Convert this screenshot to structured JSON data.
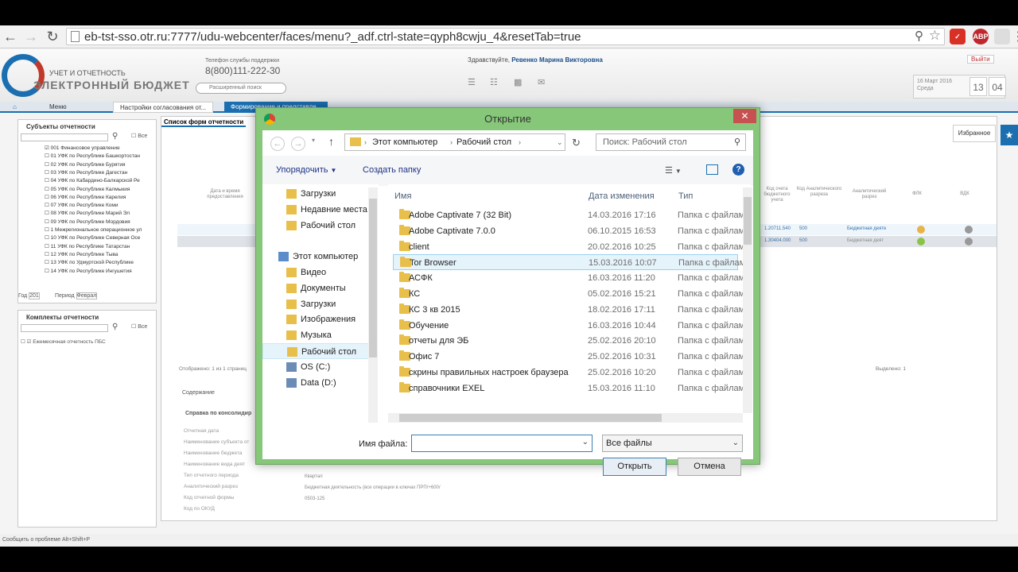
{
  "browser": {
    "url": "eb-tst-sso.otr.ru:7777/udu-webcenter/faces/menu?_adf.ctrl-state=qyph8cwju_4&resetTab=true",
    "ext_abp": "ABP"
  },
  "site": {
    "logo_sub": "УЧЕТ И ОТЧЕТНОСТЬ",
    "logo_main": "ЭЛЕКТРОННЫЙ БЮДЖЕТ",
    "hotline_label": "Телефон службы поддержки",
    "hotline": "8(800)111-222-30",
    "adv_search": "Расширенный поиск",
    "greeting_prefix": "Здравствуйте,",
    "greeting_name": "Ревенко Марина Викторовна",
    "exit": "Выйти",
    "date_line1": "16 Март 2016",
    "date_line2": "Среда",
    "date_day": "13",
    "date_month": "04",
    "favorites": "Избранное"
  },
  "tabs": [
    {
      "label": "Меню"
    },
    {
      "label": "Настройки согласования от..."
    },
    {
      "label": "Формирование и представле..."
    }
  ],
  "left_panel": {
    "title": "Субъекты отчетности",
    "all": "Все",
    "items": [
      "001 Финансовое управление",
      "01 УФК по Республике Башкортостан",
      "02 УФК по Республике Бурятия",
      "03 УФК по Республике Дагестан",
      "04 УФК по Кабардино-Балкарской Ре",
      "05 УФК по Республике Калмыкия",
      "06 УФК по Республике Карелия",
      "07 УФК по Республике Коми",
      "08 УФК по Республике Марий Эл",
      "09 УФК по Республике Мордовия",
      "1 Межрегиональное операционное ул",
      "10 УФК по Республике Северная Осе",
      "11 УФК по Республике Татарстан",
      "12 УФК по Республике Тыва",
      "13 УФК по Удмуртской Республике",
      "14 УФК по Республике Ингушетия"
    ],
    "year_label": "Год",
    "year_value": "201",
    "period_label": "Период",
    "period_value": "Феврал"
  },
  "kits_panel": {
    "title": "Комплекты отчетности",
    "all": "Все",
    "item": "Ежемесячная отчетность ПБС"
  },
  "main": {
    "tab": "Список форм отчетности",
    "col_date": "Дата и время предоставления",
    "col_form_code": "Код отчетной формы",
    "col_budget": "Код счета бюджетного учета",
    "col_analytic": "Код Аналитического разреза",
    "col_analytic2": "Аналитический разрез",
    "col_fk": "ФЛК",
    "col_vdk": "ВДК",
    "row1_budget": "1.20711.540",
    "row1_code": "500",
    "row1_text": "Бюджетная деяте",
    "row2_budget": "1.30404.000",
    "row2_code": "500",
    "row2_text": "Бюджетная деят",
    "shown": "Отображено: 1 из 1 страниц",
    "selected": "Выделено: 1",
    "content_tab": "Содержание",
    "report_ref": "Справка по консолидир",
    "fields": [
      "Отчетная дата",
      "Наименование субъекта от",
      "Наименование бюджета",
      "Наименование вида деят",
      "Тип отчетного периода",
      "Аналитический разрез",
      "Код отчетной формы",
      "Код по ОКУД"
    ],
    "field_values": [
      "Квартал",
      "Бюджетная деятельность (все операции в ключах ПРП/+600/",
      "0503-125"
    ]
  },
  "dialog": {
    "title": "Открытие",
    "path": [
      "Этот компьютер",
      "Рабочий стол"
    ],
    "search_placeholder": "Поиск: Рабочий стол",
    "organize": "Упорядочить",
    "new_folder": "Создать папку",
    "nav": [
      {
        "label": "Загрузки",
        "indent": 1
      },
      {
        "label": "Недавние места",
        "indent": 1
      },
      {
        "label": "Рабочий стол",
        "indent": 1
      },
      {
        "label": "Этот компьютер",
        "indent": 0
      },
      {
        "label": "Видео",
        "indent": 1
      },
      {
        "label": "Документы",
        "indent": 1
      },
      {
        "label": "Загрузки",
        "indent": 1
      },
      {
        "label": "Изображения",
        "indent": 1
      },
      {
        "label": "Музыка",
        "indent": 1
      },
      {
        "label": "Рабочий стол",
        "indent": 1
      },
      {
        "label": "OS (C:)",
        "indent": 1
      },
      {
        "label": "Data (D:)",
        "indent": 1
      }
    ],
    "columns": {
      "name": "Имя",
      "date": "Дата изменения",
      "type": "Тип"
    },
    "files": [
      {
        "name": "Adobe Captivate 7 (32 Bit)",
        "date": "14.03.2016 17:16",
        "type": "Папка с файлами"
      },
      {
        "name": "Adobe Captivate 7.0.0",
        "date": "06.10.2015 16:53",
        "type": "Папка с файлами"
      },
      {
        "name": "client",
        "date": "20.02.2016 10:25",
        "type": "Папка с файлами"
      },
      {
        "name": "Tor Browser",
        "date": "15.03.2016 10:07",
        "type": "Папка с файлами",
        "selected": true
      },
      {
        "name": "АСФК",
        "date": "16.03.2016 11:20",
        "type": "Папка с файлами"
      },
      {
        "name": "КС",
        "date": "05.02.2016 15:21",
        "type": "Папка с файлами"
      },
      {
        "name": "КС 3 кв 2015",
        "date": "18.02.2016 17:11",
        "type": "Папка с файлами"
      },
      {
        "name": "Обучение",
        "date": "16.03.2016 10:44",
        "type": "Папка с файлами"
      },
      {
        "name": "отчеты для ЭБ",
        "date": "25.02.2016 20:10",
        "type": "Папка с файлами"
      },
      {
        "name": "Офис 7",
        "date": "25.02.2016 10:31",
        "type": "Папка с файлами"
      },
      {
        "name": "скрины правильных настроек браузера",
        "date": "25.02.2016 10:20",
        "type": "Папка с файлами"
      },
      {
        "name": "справочники EXEL",
        "date": "15.03.2016 11:10",
        "type": "Папка с файлами"
      }
    ],
    "filename_label": "Имя файла:",
    "filename_value": "",
    "filetype": "Все файлы",
    "open": "Открыть",
    "cancel": "Отмена"
  },
  "status": "Сообщить о проблеме Alt+Shift+P",
  "colors": {
    "accent": "#1b6fb0",
    "dialog_frame": "#87c77a",
    "close": "#c75050"
  }
}
